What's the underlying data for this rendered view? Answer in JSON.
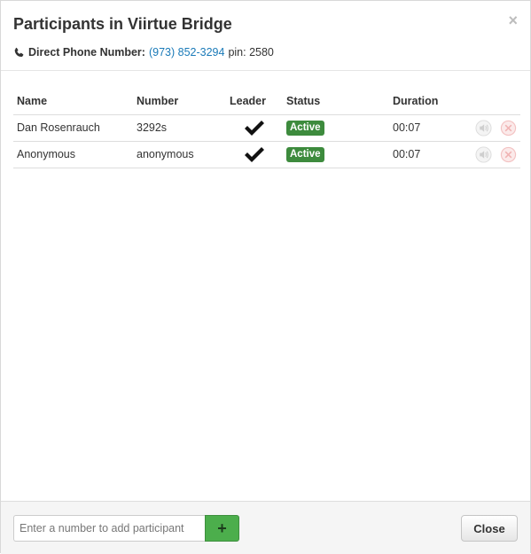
{
  "dialog": {
    "title": "Participants in Viirtue Bridge",
    "close_glyph": "×"
  },
  "phone": {
    "icon": "phone-icon",
    "label": "Direct Phone Number:",
    "number": "(973) 852-3294",
    "pin_text": "pin: 2580"
  },
  "table": {
    "headers": {
      "name": "Name",
      "number": "Number",
      "leader": "Leader",
      "status": "Status",
      "duration": "Duration"
    },
    "rows": [
      {
        "name": "Dan Rosenrauch",
        "number": "3292s",
        "leader": true,
        "status": "Active",
        "duration": "00:07"
      },
      {
        "name": "Anonymous",
        "number": "anonymous",
        "leader": true,
        "status": "Active",
        "duration": "00:07"
      }
    ]
  },
  "footer": {
    "add_placeholder": "Enter a number to add participant",
    "add_button_label": "+",
    "close_button_label": "Close"
  },
  "colors": {
    "status_active": "#3d8b3d",
    "link": "#1a7ab8",
    "add_button": "#4cae4c"
  }
}
